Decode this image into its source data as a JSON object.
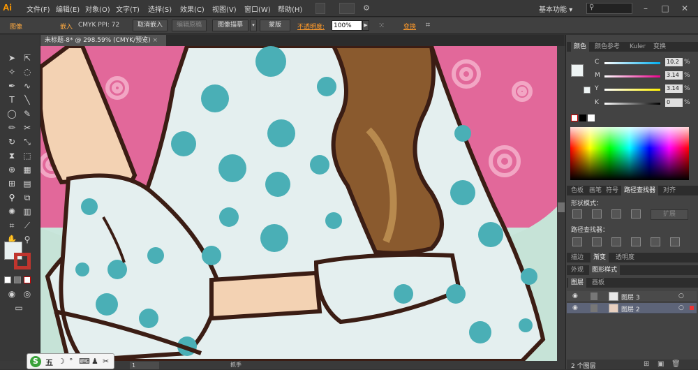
{
  "app": {
    "logo": "Ai",
    "menu": [
      "文件(F)",
      "编辑(E)",
      "对象(O)",
      "文字(T)",
      "选择(S)",
      "效果(C)",
      "视图(V)",
      "窗口(W)",
      "帮助(H)"
    ],
    "workspace": "基本功能",
    "workspace_arrow": "▾"
  },
  "controlbar": {
    "image_label": "图像",
    "embed_label": "嵌入",
    "cmyk_ppi": "CMYK  PPI: 72",
    "unembed_button": "取消嵌入",
    "edit_original_button": "编辑原稿",
    "image_trace_button": "图像描摹",
    "mask_button": "蒙版",
    "opacity_label": "不透明度:",
    "opacity_value": "100%",
    "transform_label": "变换"
  },
  "document": {
    "tab_title": "未标题-8* @ 298.59% (CMYK/预览)"
  },
  "color_panel": {
    "tabs": [
      "颜色",
      "颜色参考",
      "Kuler",
      "变换"
    ],
    "channels": [
      {
        "label": "C",
        "value": "10.2"
      },
      {
        "label": "M",
        "value": "3.14"
      },
      {
        "label": "Y",
        "value": "3.14"
      },
      {
        "label": "K",
        "value": "0"
      }
    ],
    "pct": "%"
  },
  "pathfinder_panel": {
    "tabs": [
      "色板",
      "画笔",
      "符号",
      "路径查找器",
      "对齐"
    ],
    "shape_modes_label": "形状模式：",
    "pathfinders_label": "路径查找器：",
    "expand_button": "扩展"
  },
  "stroke_tabs": [
    "描边",
    "渐变",
    "透明度"
  ],
  "appearance_tabs": [
    "外观",
    "图形样式"
  ],
  "layers_panel": {
    "tabs": [
      "图层",
      "画板"
    ],
    "layers": [
      {
        "name": "图层 3"
      },
      {
        "name": "图层 2"
      }
    ],
    "footer": "2 个图层"
  },
  "status": {
    "zoom": "1",
    "mode": "抓手"
  },
  "ime": {
    "logo": "S",
    "mode": "五",
    "icons": [
      "☽",
      "°",
      "⌨",
      "♟",
      "✂"
    ]
  },
  "colors": {
    "pink": "#e2689a",
    "dress": "#e4efef",
    "dot": "#4aafb6",
    "outline": "#3b1d14",
    "hair": "#8a5a2e",
    "skin": "#f3d2b3",
    "floor": "#c6e3d7"
  }
}
